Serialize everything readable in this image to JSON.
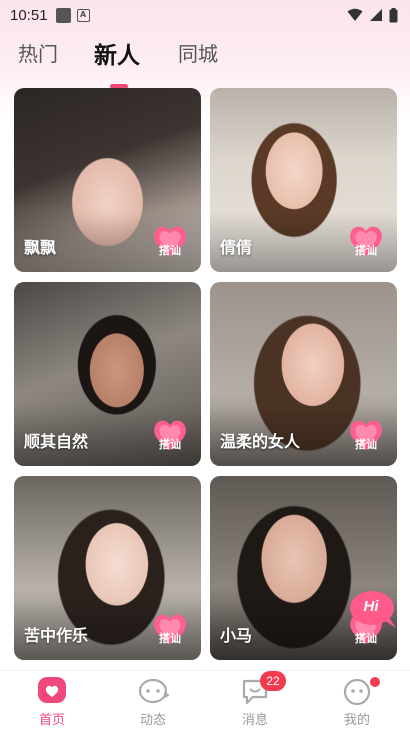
{
  "status_bar": {
    "time": "10:51",
    "a_label": "A"
  },
  "tabs": [
    {
      "label": "热门",
      "active": false
    },
    {
      "label": "新人",
      "active": true
    },
    {
      "label": "同城",
      "active": false
    }
  ],
  "chat_button_label": "搭讪",
  "profiles": [
    {
      "name": "飘飘"
    },
    {
      "name": "倩倩"
    },
    {
      "name": "顺其自然"
    },
    {
      "name": "温柔的女人"
    },
    {
      "name": "苦中作乐"
    },
    {
      "name": "小马"
    }
  ],
  "hi_button": {
    "label": "Hi"
  },
  "bottom_nav": [
    {
      "label": "首页",
      "icon": "home-heart-icon",
      "active": true
    },
    {
      "label": "动态",
      "icon": "moments-icon",
      "active": false
    },
    {
      "label": "消息",
      "icon": "message-icon",
      "active": false,
      "badge": "22"
    },
    {
      "label": "我的",
      "icon": "profile-icon",
      "active": false,
      "dot": true
    }
  ],
  "colors": {
    "accent": "#f0487a",
    "badge": "#f23b4e"
  }
}
